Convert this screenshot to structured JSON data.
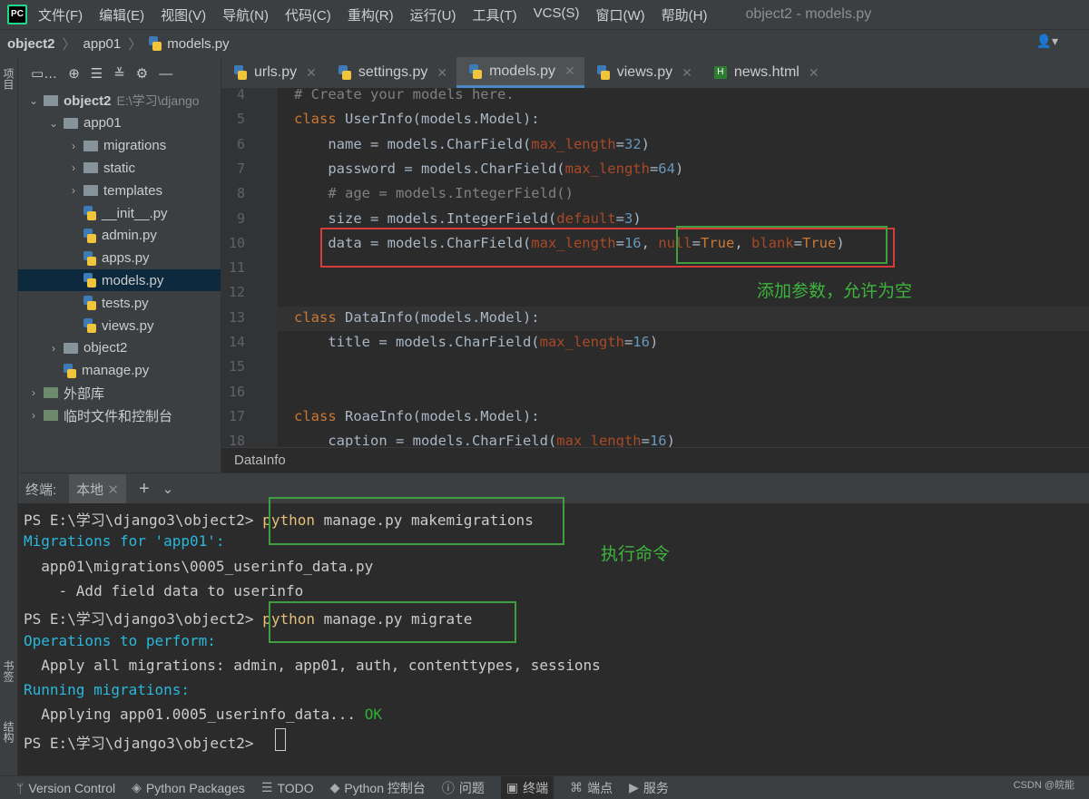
{
  "menubar": {
    "logo": "PC",
    "items": [
      "文件(F)",
      "编辑(E)",
      "视图(V)",
      "导航(N)",
      "代码(C)",
      "重构(R)",
      "运行(U)",
      "工具(T)",
      "VCS(S)",
      "窗口(W)",
      "帮助(H)"
    ],
    "title": "object2 - models.py"
  },
  "navbar": {
    "crumbs": [
      "object2",
      "app01",
      "models.py"
    ]
  },
  "left_strip": {
    "top_label": "项目",
    "mid_label": "书签",
    "bottom_label": "结构"
  },
  "project_tree": [
    {
      "label": "object2",
      "extra": "E:\\学习\\django",
      "indent": 0,
      "type": "folder",
      "arrow": "▾"
    },
    {
      "label": "app01",
      "indent": 1,
      "type": "folder",
      "arrow": "▾"
    },
    {
      "label": "migrations",
      "indent": 2,
      "type": "folder",
      "arrow": "›"
    },
    {
      "label": "static",
      "indent": 2,
      "type": "folder",
      "arrow": "›"
    },
    {
      "label": "templates",
      "indent": 2,
      "type": "folder",
      "arrow": "›"
    },
    {
      "label": "__init__.py",
      "indent": 2,
      "type": "py",
      "arrow": ""
    },
    {
      "label": "admin.py",
      "indent": 2,
      "type": "py",
      "arrow": ""
    },
    {
      "label": "apps.py",
      "indent": 2,
      "type": "py",
      "arrow": ""
    },
    {
      "label": "models.py",
      "indent": 2,
      "type": "py",
      "arrow": "",
      "selected": true
    },
    {
      "label": "tests.py",
      "indent": 2,
      "type": "py",
      "arrow": ""
    },
    {
      "label": "views.py",
      "indent": 2,
      "type": "py",
      "arrow": ""
    },
    {
      "label": "object2",
      "indent": 1,
      "type": "folder",
      "arrow": "›"
    },
    {
      "label": "manage.py",
      "indent": 1,
      "type": "py",
      "arrow": ""
    },
    {
      "label": "外部库",
      "indent": 0,
      "type": "lib",
      "arrow": "›"
    },
    {
      "label": "临时文件和控制台",
      "indent": 0,
      "type": "lib",
      "arrow": "›"
    }
  ],
  "editor_tabs": [
    {
      "label": "urls.py",
      "type": "py"
    },
    {
      "label": "settings.py",
      "type": "py"
    },
    {
      "label": "models.py",
      "type": "py",
      "active": true
    },
    {
      "label": "views.py",
      "type": "py"
    },
    {
      "label": "news.html",
      "type": "html"
    }
  ],
  "code_lines": [
    {
      "n": "4",
      "html": "<span class='cm'># Create your models here.</span>"
    },
    {
      "n": "5",
      "html": "<span class='kw'>class </span>UserInfo(models.Model):"
    },
    {
      "n": "6",
      "html": "    name = models.CharField(<span class='param'>max_length</span>=<span class='num'>32</span>)"
    },
    {
      "n": "7",
      "html": "    password = models.CharField(<span class='param'>max_length</span>=<span class='num'>64</span>)"
    },
    {
      "n": "8",
      "html": "    <span class='cm'># age = models.IntegerField()</span>"
    },
    {
      "n": "9",
      "html": "    size = models.IntegerField(<span class='param'>default</span>=<span class='num'>3</span>)"
    },
    {
      "n": "10",
      "html": "    data = models.CharField(<span class='param'>max_length</span>=<span class='num'>16</span>, <span class='param'>null</span>=<span class='kw'>True</span>, <span class='param'>blank</span>=<span class='kw'>True</span>)"
    },
    {
      "n": "11",
      "html": ""
    },
    {
      "n": "12",
      "html": ""
    },
    {
      "n": "13",
      "html": "<span class='kw'>class </span>DataInfo(models.Model):"
    },
    {
      "n": "14",
      "html": "    title = models.CharField(<span class='param'>max_length</span>=<span class='num'>16</span>)"
    },
    {
      "n": "15",
      "html": ""
    },
    {
      "n": "16",
      "html": ""
    },
    {
      "n": "17",
      "html": "<span class='kw'>class </span>RoaeInfo(models.Model):"
    },
    {
      "n": "18",
      "html": "    caption = models.CharField(<span class='param'>max_length</span>=<span class='num'>16</span>)"
    }
  ],
  "annotations": {
    "params": "添加参数，允许为空",
    "command": "执行命令"
  },
  "editor_crumb": "DataInfo",
  "terminal_header": {
    "label": "终端:",
    "tab": "本地"
  },
  "terminal_lines": [
    {
      "html": "PS E:\\学习\\django3\\object2&gt; <span class='yel'>python</span> manage.py makemigrations"
    },
    {
      "html": "<span class='cyan'>Migrations for 'app01':</span>"
    },
    {
      "html": "  app01\\migrations\\0005_userinfo_data.py"
    },
    {
      "html": "    - Add field data to userinfo"
    },
    {
      "html": "PS E:\\学习\\django3\\object2&gt; <span class='yel'>python</span> manage.py migrate"
    },
    {
      "html": "<span class='cyan'>Operations to perform:</span>"
    },
    {
      "html": "  Apply all migrations: admin, app01, auth, contenttypes, sessions"
    },
    {
      "html": "<span class='cyan'>Running migrations:</span>"
    },
    {
      "html": "  Applying app01.0005_userinfo_data... <span class='okc'>OK</span>"
    },
    {
      "html": "PS E:\\学习\\django3\\object2&gt; "
    }
  ],
  "statusbar": [
    {
      "label": "Version Control",
      "icon": "branch-icon"
    },
    {
      "label": "Python Packages",
      "icon": "layers-icon"
    },
    {
      "label": "TODO",
      "icon": "list-icon"
    },
    {
      "label": "Python 控制台",
      "icon": "python-icon"
    },
    {
      "label": "问题",
      "icon": "info-icon"
    },
    {
      "label": "终端",
      "icon": "terminal-icon",
      "active": true
    },
    {
      "label": "端点",
      "icon": "endpoints-icon"
    },
    {
      "label": "服务",
      "icon": "play-icon"
    }
  ],
  "watermark": "CSDN @皖能"
}
